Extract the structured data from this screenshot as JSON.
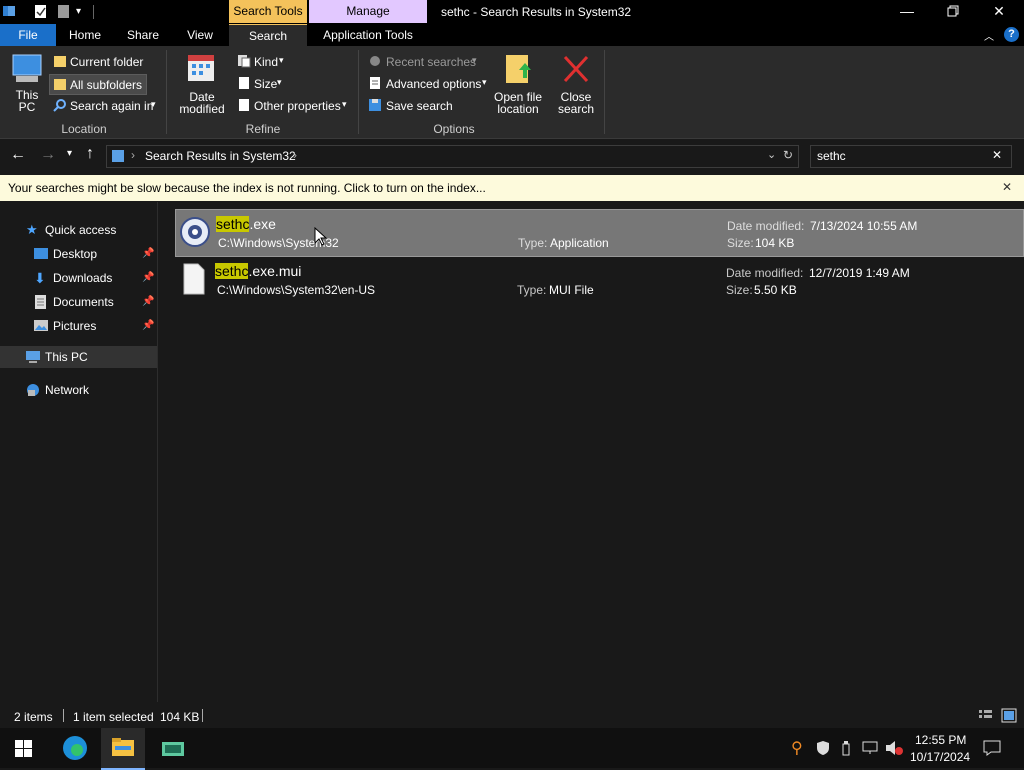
{
  "window": {
    "title": "sethc - Search Results in System32",
    "context_tabs": {
      "search_tools": "Search Tools",
      "manage": "Manage"
    },
    "tabs": [
      "File",
      "Home",
      "Share",
      "View",
      "Search",
      "Application Tools"
    ],
    "active_tab": "Search",
    "help": "?"
  },
  "ribbon": {
    "location": {
      "this_pc": [
        "This",
        "PC"
      ],
      "current_folder": "Current folder",
      "all_subfolders": "All subfolders",
      "search_again_in": "Search again in",
      "group_label": "Location"
    },
    "refine": {
      "date_modified": [
        "Date",
        "modified"
      ],
      "kind": "Kind",
      "size": "Size",
      "other_properties": "Other properties",
      "group_label": "Refine"
    },
    "options": {
      "recent_searches": "Recent searches",
      "advanced_options": "Advanced options",
      "save_search": "Save search",
      "open_file_location": [
        "Open file",
        "location"
      ],
      "close_search": [
        "Close",
        "search"
      ],
      "group_label": "Options"
    }
  },
  "address": {
    "path": "Search Results in System32",
    "search_value": "sethc"
  },
  "infobar": {
    "text": "Your searches might be slow because the index is not running.  Click to turn on the index..."
  },
  "navpane": {
    "items": [
      {
        "label": "Quick access",
        "pinned": false
      },
      {
        "label": "Desktop",
        "pinned": true
      },
      {
        "label": "Downloads",
        "pinned": true
      },
      {
        "label": "Documents",
        "pinned": true
      },
      {
        "label": "Pictures",
        "pinned": true
      },
      {
        "label": "This PC",
        "pinned": false
      },
      {
        "label": "Network",
        "pinned": false
      }
    ]
  },
  "results": [
    {
      "name_match": "sethc",
      "name_rest": "exe",
      "path": "C:\\Windows\\System32",
      "type_label": "Type:",
      "type": "Application",
      "date_label": "Date modified:",
      "date": "7/13/2024 10:55 AM",
      "size_label": "Size:",
      "size": "104 KB",
      "selected": true
    },
    {
      "name_match": "sethc",
      "name_rest": "exe.mui",
      "path": "C:\\Windows\\System32\\en-US",
      "type_label": "Type:",
      "type": "MUI File",
      "date_label": "Date modified:",
      "date": "12/7/2019 1:49 AM",
      "size_label": "Size:",
      "size": "5.50 KB",
      "selected": false
    }
  ],
  "status": {
    "items_count": "2 items",
    "selected": "1 item selected",
    "size": "104 KB"
  },
  "taskbar": {
    "time": "12:55 PM",
    "date": "10/17/2024"
  },
  "colors": {
    "file_tab": "#1a6fc9",
    "search_tools": "#f4c25b",
    "manage": "#e2c8ff",
    "highlight": "#c8c800",
    "infobar": "#fdfadc"
  }
}
